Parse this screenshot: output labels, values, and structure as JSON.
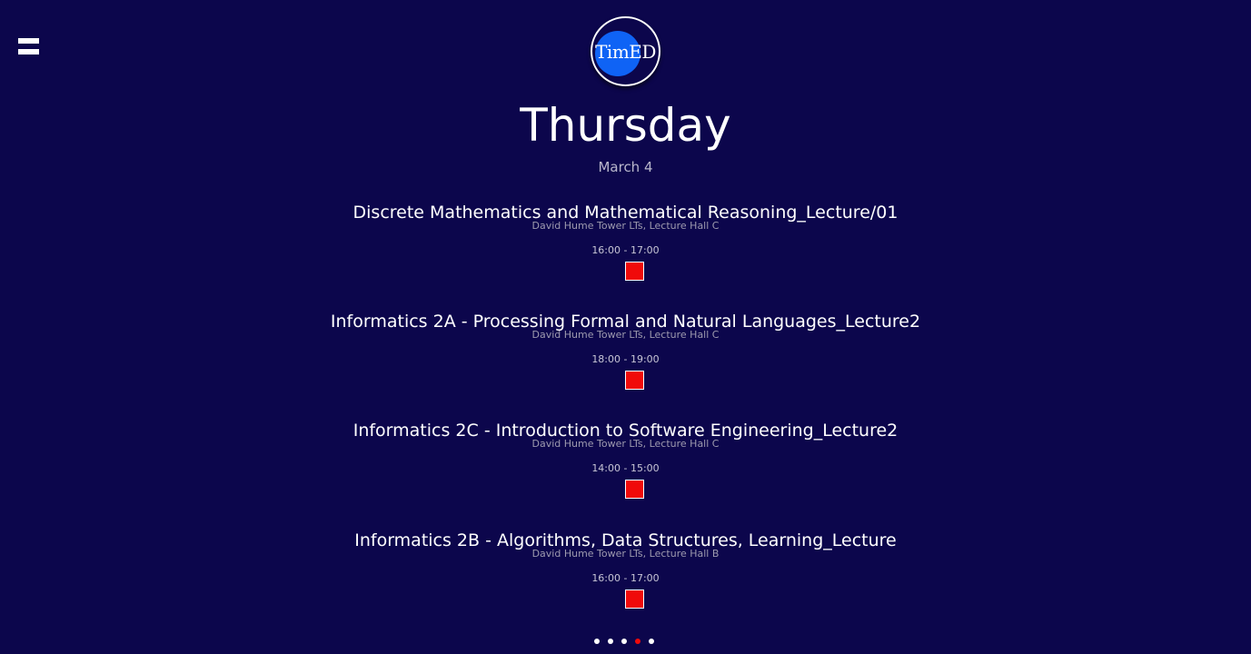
{
  "header": {
    "logo_text": "TimED",
    "day": "Thursday",
    "date": "March 4"
  },
  "events": [
    {
      "title": "Discrete Mathematics and Mathematical Reasoning_Lecture/01",
      "location": "David Hume Tower LTs, Lecture Hall C",
      "time": "16:00 - 17:00"
    },
    {
      "title": "Informatics 2A - Processing Formal and Natural Languages_Lecture2",
      "location": "David Hume Tower LTs, Lecture Hall C",
      "time": "18:00 - 19:00"
    },
    {
      "title": "Informatics 2C - Introduction to Software Engineering_Lecture2",
      "location": "David Hume Tower LTs, Lecture Hall C",
      "time": "14:00 - 15:00"
    },
    {
      "title": "Informatics 2B - Algorithms, Data Structures, Learning_Lecture",
      "location": "David Hume Tower LTs, Lecture Hall B",
      "time": "16:00 - 17:00"
    }
  ],
  "pagination": {
    "total": 5,
    "active_index": 3
  },
  "colors": {
    "background": "#0c064c",
    "logo_accent": "#0f63f5",
    "status_box": "#f00a0a",
    "active_dot": "#f00a0a"
  },
  "icons": {
    "menu": "hamburger-menu-icon"
  }
}
